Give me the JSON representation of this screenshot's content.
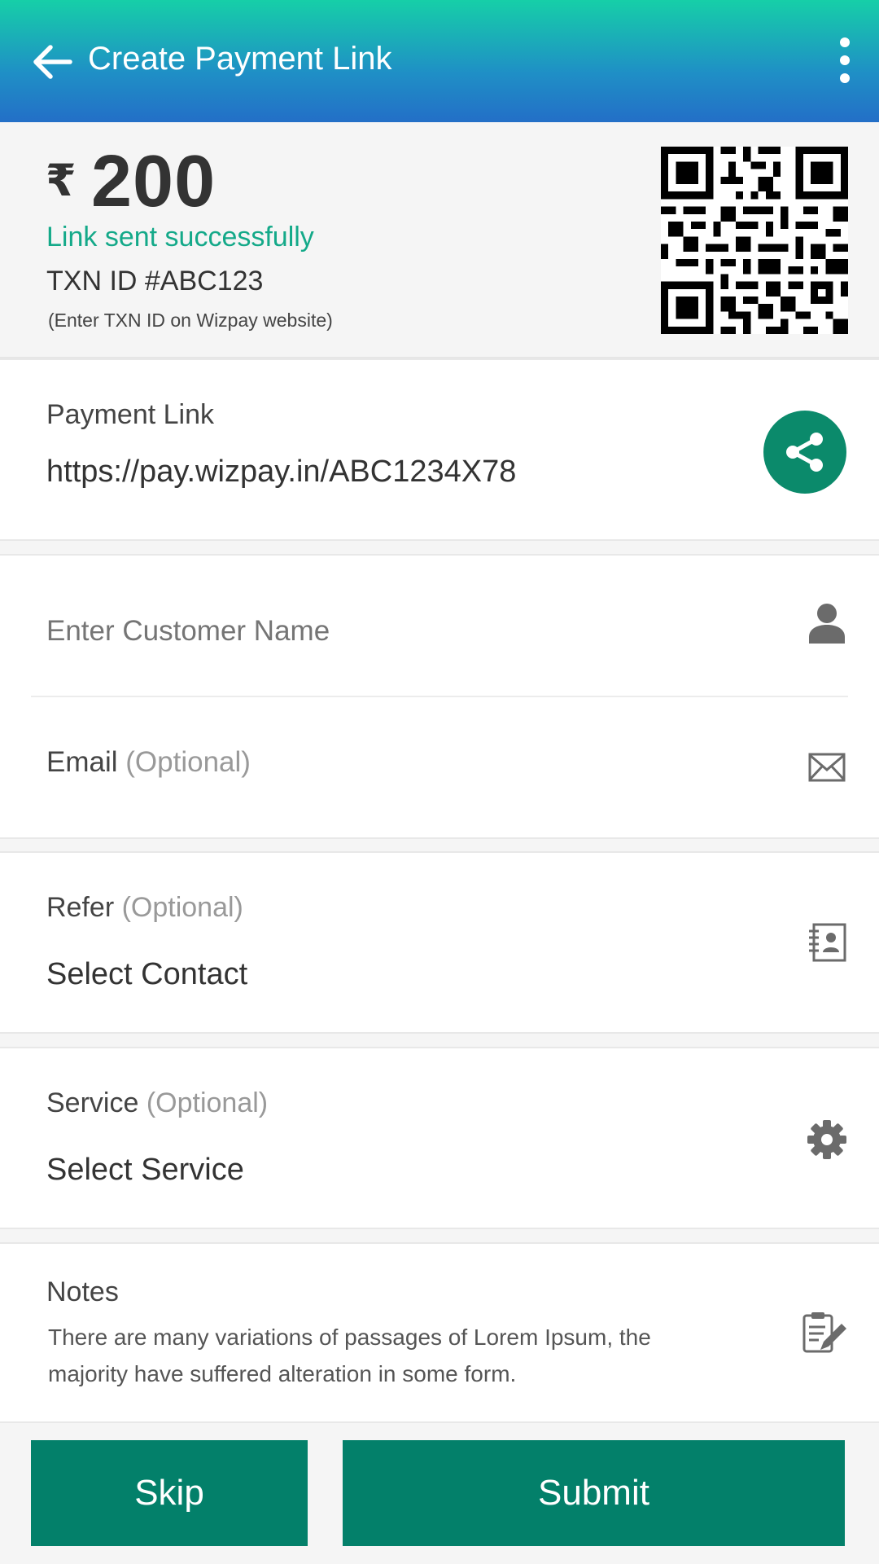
{
  "header": {
    "title": "Create Payment Link",
    "back_icon": "arrow-left-icon",
    "menu_icon": "more-vertical-icon"
  },
  "summary": {
    "currency_symbol": "₹",
    "amount": "200",
    "status": "Link sent successfully",
    "txn_id": "TXN ID #ABC123",
    "hint": "(Enter TXN ID on Wizpay website)"
  },
  "payment_link": {
    "label": "Payment Link",
    "url": "https://pay.wizpay.in/ABC1234X78",
    "share_icon": "share-icon"
  },
  "customer": {
    "name_placeholder": "Enter Customer Name",
    "email_label": "Email",
    "email_optional": "(Optional)",
    "name_icon": "person-icon",
    "email_icon": "mail-icon"
  },
  "refer": {
    "label": "Refer",
    "optional": "(Optional)",
    "value": "Select Contact",
    "icon": "contact-book-icon"
  },
  "service": {
    "label": "Service",
    "optional": "(Optional)",
    "value": "Select Service",
    "icon": "gear-icon"
  },
  "notes": {
    "label": "Notes",
    "text": "There are many variations of passages of Lorem Ipsum, the majority have suffered alteration in some form.",
    "icon": "edit-note-icon"
  },
  "actions": {
    "skip": "Skip",
    "submit": "Submit"
  },
  "colors": {
    "accent": "#03806a",
    "success_text": "#14a989",
    "header_top": "#16cfa8",
    "header_bottom": "#236fc7"
  }
}
